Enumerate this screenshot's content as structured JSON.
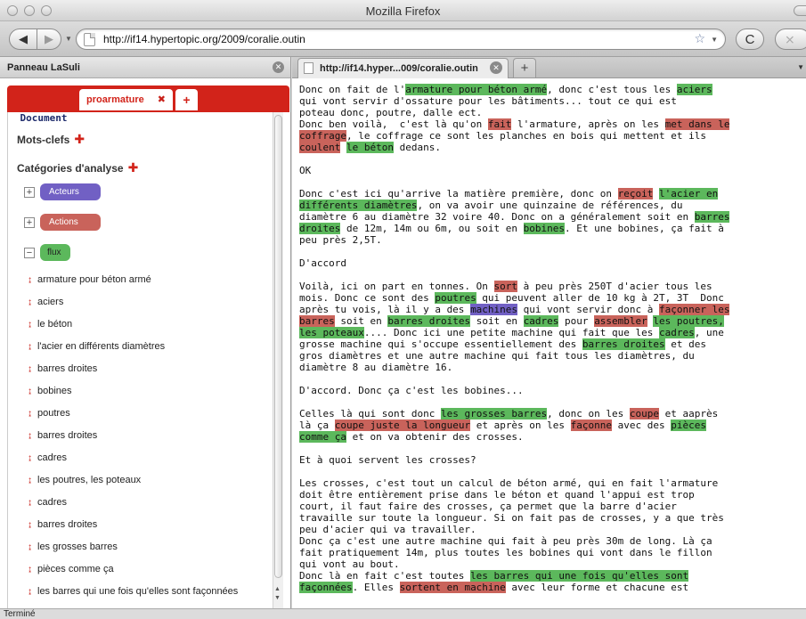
{
  "window": {
    "title": "Mozilla Firefox"
  },
  "nav": {
    "back_icon": "◀",
    "forward_icon": "▶",
    "url": "http://if14.hypertopic.org/2009/coralie.outin",
    "bookmark_icon": "☆",
    "reload_icon": "C",
    "stop_icon": "⨯"
  },
  "sidebar": {
    "title": "Panneau LaSuli",
    "tabs": [
      {
        "label": "Document"
      },
      {
        "label": "proarmature"
      },
      {
        "label": "+"
      }
    ],
    "keywords_heading": "Mots-clefs",
    "categories_heading": "Catégories d'analyse",
    "categories": [
      {
        "label": "Acteurs",
        "toggle": "+",
        "color": "#7160c4"
      },
      {
        "label": "Actions",
        "toggle": "+",
        "color": "#c9635b"
      },
      {
        "label": "flux",
        "toggle": "−",
        "color": "#5cb85c"
      }
    ],
    "items": [
      "armature pour béton armé",
      "aciers",
      "le béton",
      "l'acier en différents diamètres",
      "barres droites",
      "bobines",
      "poutres",
      "barres droites",
      "cadres",
      "les poutres, les poteaux",
      "cadres",
      "barres droites",
      "les grosses barres",
      "pièces comme ça",
      "les barres qui une fois qu'elles sont façonnées"
    ]
  },
  "page": {
    "tab_title": "http://if14.hyper...009/coralie.outin",
    "paragraphs": [
      [
        {
          "t": "Donc on fait de l'"
        },
        {
          "t": "armature pour béton armé",
          "c": "g"
        },
        {
          "t": ", donc c'est tous les "
        },
        {
          "t": "aciers",
          "c": "g"
        },
        {
          "t": "\nqui vont servir d'ossature pour les bâtiments... tout ce qui est\npoteau donc, poutre, dalle ect.\nDonc ben voilà,  c'est là qu'on "
        },
        {
          "t": "fait",
          "c": "r"
        },
        {
          "t": " l'armature, après on les "
        },
        {
          "t": "met dans le\ncoffrage",
          "c": "r"
        },
        {
          "t": ", le coffrage ce sont les planches en bois qui mettent et ils\n"
        },
        {
          "t": "coulent",
          "c": "r"
        },
        {
          "t": " "
        },
        {
          "t": "le béton",
          "c": "g"
        },
        {
          "t": " dedans."
        }
      ],
      [
        {
          "t": "OK"
        }
      ],
      [
        {
          "t": "Donc c'est ici qu'arrive la matière première, donc on "
        },
        {
          "t": "reçoit",
          "c": "r"
        },
        {
          "t": " "
        },
        {
          "t": "l'acier en\ndifférents diamètres",
          "c": "g"
        },
        {
          "t": ", on va avoir une quinzaine de références, du\ndiamètre 6 au diamètre 32 voire 40. Donc on a généralement soit en "
        },
        {
          "t": "barres\ndroites",
          "c": "g"
        },
        {
          "t": " de 12m, 14m ou 6m, ou soit en "
        },
        {
          "t": "bobines",
          "c": "g"
        },
        {
          "t": ". Et une bobines, ça fait à\npeu près 2,5T."
        }
      ],
      [
        {
          "t": "D'accord"
        }
      ],
      [
        {
          "t": "Voilà, ici on part en tonnes. On "
        },
        {
          "t": "sort",
          "c": "r"
        },
        {
          "t": " à peu près 250T d'acier tous les\nmois. Donc ce sont des "
        },
        {
          "t": "poutres",
          "c": "g"
        },
        {
          "t": " qui peuvent aller de 10 kg à 2T, 3T  Donc\naprès tu vois, là il y a des "
        },
        {
          "t": "machines",
          "c": "b"
        },
        {
          "t": " qui vont servir donc à "
        },
        {
          "t": "façonner les\nbarres",
          "c": "r"
        },
        {
          "t": " soit en "
        },
        {
          "t": "barres droites",
          "c": "g"
        },
        {
          "t": " soit en "
        },
        {
          "t": "cadres",
          "c": "g"
        },
        {
          "t": " pour "
        },
        {
          "t": "assembler",
          "c": "r"
        },
        {
          "t": " "
        },
        {
          "t": "les poutres,\nles poteaux",
          "c": "g"
        },
        {
          "t": ".... Donc ici une petite machine qui fait que les "
        },
        {
          "t": "cadres",
          "c": "g"
        },
        {
          "t": ", une\ngrosse machine qui s'occupe essentiellement des "
        },
        {
          "t": "barres droites",
          "c": "g"
        },
        {
          "t": " et des\ngros diamètres et une autre machine qui fait tous les diamètres, du\ndiamètre 8 au diamètre 16."
        }
      ],
      [
        {
          "t": "D'accord. Donc ça c'est les bobines..."
        }
      ],
      [
        {
          "t": "Celles là qui sont donc "
        },
        {
          "t": "les grosses barres",
          "c": "g"
        },
        {
          "t": ", donc on les "
        },
        {
          "t": "coupe",
          "c": "r"
        },
        {
          "t": " et aaprès\nlà ça "
        },
        {
          "t": "coupe juste la longueur",
          "c": "r"
        },
        {
          "t": " et après on les "
        },
        {
          "t": "façonne",
          "c": "r"
        },
        {
          "t": " avec des "
        },
        {
          "t": "pièces\ncomme ça",
          "c": "g"
        },
        {
          "t": " et on va obtenir des crosses."
        }
      ],
      [
        {
          "t": "Et à quoi servent les crosses?"
        }
      ],
      [
        {
          "t": "Les crosses, c'est tout un calcul de béton armé, qui en fait l'armature\ndoit être entièrement prise dans le béton et quand l'appui est trop\ncourt, il faut faire des crosses, ça permet que la barre d'acier\ntravaille sur toute la longueur. Si on fait pas de crosses, y a que très\npeu d'acier qui va travailler.\nDonc ça c'est une autre machine qui fait à peu près 30m de long. Là ça\nfait pratiquement 14m, plus toutes les bobines qui vont dans le fillon\nqui vont au bout.\nDonc là en fait c'est toutes "
        },
        {
          "t": "les barres qui une fois qu'elles sont\nfaçonnées",
          "c": "g"
        },
        {
          "t": ". Elles "
        },
        {
          "t": "sortent en machine",
          "c": "r"
        },
        {
          "t": " avec leur forme et chacune est"
        }
      ]
    ]
  },
  "status": {
    "text": "Terminé"
  }
}
